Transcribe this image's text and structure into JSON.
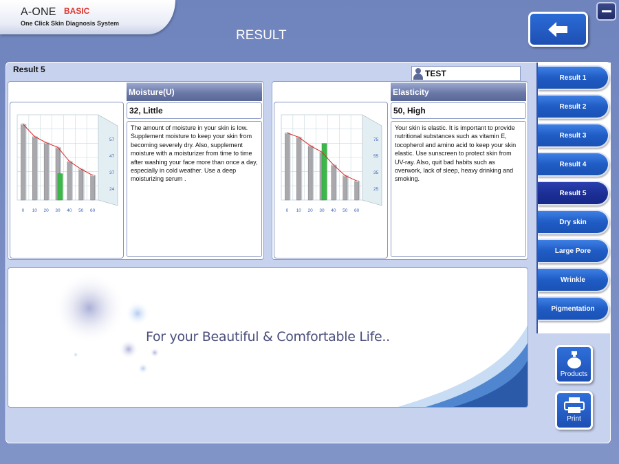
{
  "app": {
    "logo_title": "A-ONE",
    "logo_badge": "BASIC",
    "logo_subtitle": "One Click Skin Diagnosis System",
    "page_title": "RESULT"
  },
  "main": {
    "result_label": "Result 5",
    "user_name": "TEST"
  },
  "cards": [
    {
      "metric": "Moisture(U)",
      "value_text": "32,  Little",
      "description": "The amount of moisture in your skin is low. Supplement moisture to keep your skin from becoming severely dry. Also, supplement moisture with a moisturizer from time to time after washing your face more than once a day, especially in cold weather. Use a deep moisturizing serum .",
      "chart_data": {
        "type": "bar",
        "categories": [
          "0",
          "10",
          "20",
          "30",
          "40",
          "50",
          "60"
        ],
        "values": [
          64,
          56,
          52,
          49,
          40,
          35,
          31
        ],
        "line_values": [
          64,
          56,
          52,
          49,
          40,
          35,
          31
        ],
        "highlight_index": 3,
        "highlight_value": 32,
        "y_ticks": [
          "57",
          "47",
          "37",
          "24"
        ],
        "ylim": [
          15,
          70
        ]
      }
    },
    {
      "metric": "Elasticity",
      "value_text": "50,  High",
      "description": "Your skin is elastic. It is important to provide nutritional substances such as vitamin E, tocopherol  and amino acid to keep your skin elastic. Use sunscreen to protect skin from UV-ray. Also, quit bad habits such as overwork, lack of sleep, heavy drinking and smoking.",
      "chart_data": {
        "type": "bar",
        "categories": [
          "0",
          "10",
          "20",
          "30",
          "40",
          "50",
          "60"
        ],
        "values": [
          78,
          74,
          66,
          60,
          48,
          38,
          33
        ],
        "line_values": [
          78,
          74,
          66,
          60,
          48,
          38,
          33
        ],
        "highlight_index": 3,
        "highlight_value": 68,
        "y_ticks": [
          "75",
          "55",
          "35",
          "25"
        ],
        "ylim": [
          15,
          95
        ]
      }
    }
  ],
  "banner": {
    "text": "For your Beautiful & Comfortable Life.."
  },
  "side_nav": {
    "items": [
      {
        "label": "Result 1"
      },
      {
        "label": "Result 2"
      },
      {
        "label": "Result 3"
      },
      {
        "label": "Result 4"
      },
      {
        "label": "Result 5"
      },
      {
        "label": "Dry skin"
      },
      {
        "label": "Large Pore"
      },
      {
        "label": "Wrinkle"
      },
      {
        "label": "Pigmentation"
      }
    ],
    "active_index": 4
  },
  "actions": {
    "products_label": "Products",
    "print_label": "Print"
  },
  "colors": {
    "accent_blue": "#1f5cc5",
    "active_nav": "#1a2d92",
    "highlight_bar": "#3cb84a",
    "trend_line": "#e02020",
    "logo_badge": "#e0322a"
  },
  "icons": {
    "back": "arrow-left-icon",
    "minimize": "minimize-icon",
    "user": "user-icon",
    "products": "product-bottle-icon",
    "print": "printer-icon"
  }
}
